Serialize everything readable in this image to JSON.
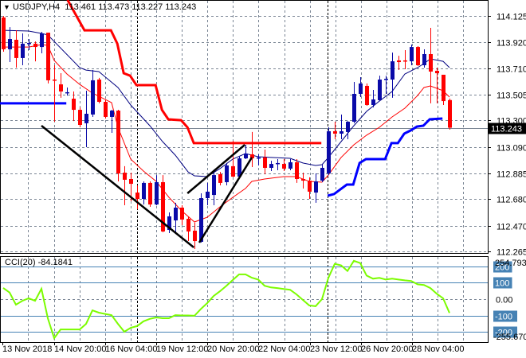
{
  "header": {
    "symbol": "USDJPY,H4",
    "open": "113.461",
    "high": "113.473",
    "low": "113.227",
    "close": "113.243"
  },
  "cci_header": {
    "label": "CCI(20)",
    "value": "-84.1841"
  },
  "colors": {
    "bull": "#0a0aa8",
    "bear": "#ff0000",
    "ma_fast": "#000080",
    "ma_slow": "#ff0000",
    "resistance": "#ff0000",
    "support": "#0000ff",
    "cci": "#7cfc00",
    "cci_levels": "#4682b4",
    "trendline": "#000000"
  },
  "chart_data": [
    {
      "type": "candlestick",
      "title": "USDJPY,H4",
      "price_ticks": [
        "114.125",
        "113.920",
        "113.710",
        "113.505",
        "113.300",
        "113.090",
        "112.885",
        "112.680",
        "112.470",
        "112.265"
      ],
      "current_price": "113.243",
      "ylim": [
        112.265,
        114.125
      ],
      "x_labels": [
        "13 Nov 2018",
        "14 Nov 20:00",
        "16 Nov 04:00",
        "19 Nov 12:00",
        "20 Nov 20:00",
        "22 Nov 04:00",
        "23 Nov 12:00",
        "26 Nov 20:00",
        "28 Nov 04:00"
      ],
      "candles_ohlc": [
        [
          114.113,
          114.125,
          113.843,
          113.862
        ],
        [
          113.862,
          114.037,
          113.761,
          113.943
        ],
        [
          113.937,
          114.012,
          113.717,
          113.793
        ],
        [
          113.793,
          113.987,
          113.736,
          113.906
        ],
        [
          113.906,
          113.943,
          113.855,
          113.912
        ],
        [
          113.906,
          113.924,
          113.767,
          113.88
        ],
        [
          113.88,
          114.0,
          113.83,
          113.987
        ],
        [
          113.993,
          113.993,
          113.592,
          113.617
        ],
        [
          113.623,
          113.736,
          113.29,
          113.617
        ],
        [
          113.585,
          113.673,
          113.479,
          113.529
        ],
        [
          113.517,
          113.56,
          113.497,
          113.523
        ],
        [
          113.472,
          113.529,
          113.296,
          113.384
        ],
        [
          113.384,
          113.403,
          113.246,
          113.265
        ],
        [
          113.278,
          113.535,
          113.089,
          113.353
        ],
        [
          113.347,
          113.698,
          113.328,
          113.617
        ],
        [
          113.623,
          113.636,
          113.435,
          113.447
        ],
        [
          113.447,
          113.466,
          113.315,
          113.328
        ],
        [
          113.328,
          113.384,
          113.202,
          113.378
        ],
        [
          113.378,
          113.384,
          112.819,
          112.882
        ],
        [
          112.888,
          112.939,
          112.631,
          112.832
        ],
        [
          112.838,
          112.888,
          112.662,
          112.8
        ],
        [
          112.731,
          112.788,
          112.599,
          112.681
        ],
        [
          112.681,
          112.819,
          112.637,
          112.807
        ],
        [
          112.807,
          112.819,
          112.618,
          112.637
        ],
        [
          112.637,
          112.869,
          112.631,
          112.813
        ],
        [
          112.813,
          112.869,
          112.417,
          112.424
        ],
        [
          112.436,
          112.574,
          112.411,
          112.543
        ],
        [
          112.511,
          112.65,
          112.417,
          112.612
        ],
        [
          112.612,
          112.631,
          112.474,
          112.518
        ],
        [
          112.524,
          112.543,
          112.348,
          112.424
        ],
        [
          112.43,
          112.493,
          112.285,
          112.348
        ],
        [
          112.342,
          112.725,
          112.336,
          112.687
        ],
        [
          112.687,
          112.807,
          112.631,
          112.738
        ],
        [
          112.712,
          112.913,
          112.631,
          112.869
        ],
        [
          112.876,
          112.894,
          112.788,
          112.807
        ],
        [
          112.813,
          112.964,
          112.788,
          112.945
        ],
        [
          112.939,
          113.139,
          112.851,
          112.857
        ],
        [
          112.857,
          113.014,
          112.844,
          113.001
        ],
        [
          113.001,
          113.108,
          112.995,
          113.039
        ],
        [
          113.033,
          113.209,
          112.932,
          113.001
        ],
        [
          113.001,
          113.033,
          112.945,
          113.008
        ],
        [
          113.008,
          113.07,
          112.876,
          112.926
        ],
        [
          112.926,
          112.982,
          112.901,
          112.957
        ],
        [
          112.957,
          112.995,
          112.907,
          112.964
        ],
        [
          112.957,
          112.995,
          112.901,
          112.92
        ],
        [
          112.92,
          112.995,
          112.907,
          112.97
        ],
        [
          112.97,
          112.995,
          112.807,
          112.838
        ],
        [
          112.838,
          112.888,
          112.763,
          112.825
        ],
        [
          112.825,
          112.851,
          112.681,
          112.738
        ],
        [
          112.731,
          112.882,
          112.65,
          112.819
        ],
        [
          112.825,
          112.951,
          112.813,
          112.926
        ],
        [
          112.882,
          113.246,
          112.869,
          113.215
        ],
        [
          113.215,
          113.29,
          113.152,
          113.196
        ],
        [
          113.196,
          113.347,
          113.152,
          113.215
        ],
        [
          113.209,
          113.296,
          113.152,
          113.29
        ],
        [
          113.29,
          113.604,
          113.278,
          113.51
        ],
        [
          113.51,
          113.642,
          113.485,
          113.592
        ],
        [
          113.573,
          113.592,
          113.416,
          113.422
        ],
        [
          113.422,
          113.541,
          113.403,
          113.466
        ],
        [
          113.46,
          113.654,
          113.453,
          113.623
        ],
        [
          113.623,
          113.654,
          113.51,
          113.629
        ],
        [
          113.623,
          113.836,
          113.479,
          113.767
        ],
        [
          113.774,
          113.811,
          113.698,
          113.761
        ],
        [
          113.774,
          113.855,
          113.705,
          113.767
        ],
        [
          113.767,
          113.899,
          113.736,
          113.88
        ],
        [
          113.88,
          113.887,
          113.73,
          113.736
        ],
        [
          113.736,
          113.862,
          113.717,
          113.824
        ],
        [
          113.824,
          114.031,
          113.435,
          113.686
        ],
        [
          113.692,
          113.717,
          113.435,
          113.673
        ],
        [
          113.661,
          113.661,
          113.422,
          113.453
        ],
        [
          113.461,
          113.473,
          113.227,
          113.243
        ]
      ],
      "ma_fast": [
        [
          1,
          114.012
        ],
        [
          5,
          114.006
        ],
        [
          7,
          113.987
        ],
        [
          8,
          113.975
        ],
        [
          13,
          113.717
        ],
        [
          14,
          113.698
        ],
        [
          16,
          113.686
        ],
        [
          19,
          113.56
        ],
        [
          21,
          113.422
        ],
        [
          24,
          113.259
        ],
        [
          26,
          113.133
        ],
        [
          28,
          113.026
        ],
        [
          30,
          112.894
        ],
        [
          31,
          112.863
        ],
        [
          33,
          112.857
        ],
        [
          35,
          112.92
        ],
        [
          37,
          112.995
        ],
        [
          39,
          113.039
        ],
        [
          41,
          113.014
        ],
        [
          43,
          113.008
        ],
        [
          46,
          113.001
        ],
        [
          48,
          112.964
        ],
        [
          50,
          112.945
        ],
        [
          51,
          112.951
        ],
        [
          52,
          113.008
        ],
        [
          54,
          113.133
        ],
        [
          56,
          113.259
        ],
        [
          58,
          113.372
        ],
        [
          60,
          113.453
        ],
        [
          62,
          113.529
        ],
        [
          64,
          113.667
        ],
        [
          66,
          113.717
        ],
        [
          67,
          113.749
        ],
        [
          68,
          113.786
        ],
        [
          70,
          113.767
        ],
        [
          71,
          113.717
        ]
      ],
      "ma_slow": [
        [
          1,
          113.88
        ],
        [
          5,
          113.88
        ],
        [
          7,
          113.899
        ],
        [
          8,
          113.893
        ],
        [
          9,
          113.774
        ],
        [
          11,
          113.667
        ],
        [
          13,
          113.585
        ],
        [
          15,
          113.516
        ],
        [
          18,
          113.441
        ],
        [
          19,
          113.246
        ],
        [
          21,
          112.995
        ],
        [
          23,
          112.901
        ],
        [
          25,
          112.819
        ],
        [
          27,
          112.693
        ],
        [
          29,
          112.587
        ],
        [
          31,
          112.499
        ],
        [
          33,
          112.536
        ],
        [
          35,
          112.618
        ],
        [
          37,
          112.693
        ],
        [
          39,
          112.763
        ],
        [
          40,
          112.819
        ],
        [
          42,
          112.838
        ],
        [
          45,
          112.857
        ],
        [
          47,
          112.857
        ],
        [
          49,
          112.819
        ],
        [
          51,
          112.813
        ],
        [
          52,
          112.869
        ],
        [
          54,
          113.008
        ],
        [
          56,
          113.108
        ],
        [
          58,
          113.184
        ],
        [
          60,
          113.246
        ],
        [
          62,
          113.328
        ],
        [
          64,
          113.397
        ],
        [
          66,
          113.497
        ],
        [
          67,
          113.56
        ],
        [
          68,
          113.573
        ],
        [
          70,
          113.535
        ],
        [
          71,
          113.485
        ]
      ],
      "resistance_steps": [
        [
          11.1,
          114.251
        ],
        [
          13.75,
          114.012
        ],
        [
          17.9,
          114.012
        ],
        [
          18.9,
          113.906
        ],
        [
          19.9,
          113.673
        ],
        [
          20.9,
          113.654
        ],
        [
          21.9,
          113.579
        ],
        [
          24.9,
          113.579
        ],
        [
          25.9,
          113.384
        ],
        [
          26.9,
          113.309
        ],
        [
          28.9,
          113.302
        ],
        [
          29.9,
          113.246
        ],
        [
          30.9,
          113.121
        ],
        [
          50.9,
          113.121
        ]
      ],
      "support_steps_1": [
        [
          0.5,
          113.435
        ],
        [
          10.9,
          113.435
        ]
      ],
      "support_steps_2": [
        [
          51.9,
          112.706
        ],
        [
          52.9,
          112.719
        ],
        [
          53.9,
          112.757
        ],
        [
          54.9,
          112.794
        ],
        [
          55.9,
          112.794
        ],
        [
          56.9,
          112.964
        ],
        [
          57.9,
          112.995
        ],
        [
          60.9,
          112.995
        ],
        [
          61.9,
          113.121
        ],
        [
          62.9,
          113.121
        ],
        [
          63.9,
          113.196
        ],
        [
          64.9,
          113.221
        ],
        [
          65.9,
          113.252
        ],
        [
          66.9,
          113.259
        ],
        [
          67.9,
          113.309
        ],
        [
          69.9,
          113.315
        ]
      ],
      "trendlines": [
        [
          [
            7,
            113.259
          ],
          [
            30.9,
            112.298
          ]
        ],
        [
          [
            29.9,
            112.725
          ],
          [
            38.9,
            113.108
          ]
        ],
        [
          [
            31.75,
            112.336
          ],
          [
            40,
            113.008
          ]
        ]
      ]
    },
    {
      "type": "line",
      "title": "CCI(20)",
      "ylim": [
        -255.6701,
        254.793
      ],
      "range_labels": [
        "254.793",
        "-255.6701"
      ],
      "levels": [
        {
          "value": 200,
          "label": "200"
        },
        {
          "value": 100,
          "label": "100"
        },
        {
          "value": 0,
          "label": "0.00"
        },
        {
          "value": -100,
          "label": "-100"
        },
        {
          "value": -200,
          "label": "-200"
        }
      ],
      "values": [
        68,
        40,
        -34,
        -10,
        5,
        -10,
        63,
        -116,
        -237,
        -184,
        -184,
        -184,
        -184,
        -150,
        -68,
        -82,
        -90,
        -97,
        -150,
        -198,
        -174,
        -164,
        -135,
        -120,
        -111,
        -116,
        -116,
        -97,
        -99,
        -99,
        -101,
        -60,
        -24,
        19,
        48,
        80,
        116,
        150,
        150,
        130,
        119,
        81,
        71,
        67,
        62,
        57,
        29,
        -5,
        -38,
        -43,
        0,
        129,
        214,
        205,
        171,
        233,
        219,
        143,
        124,
        129,
        119,
        124,
        119,
        114,
        110,
        90,
        86,
        67,
        33,
        5,
        -84
      ]
    }
  ]
}
